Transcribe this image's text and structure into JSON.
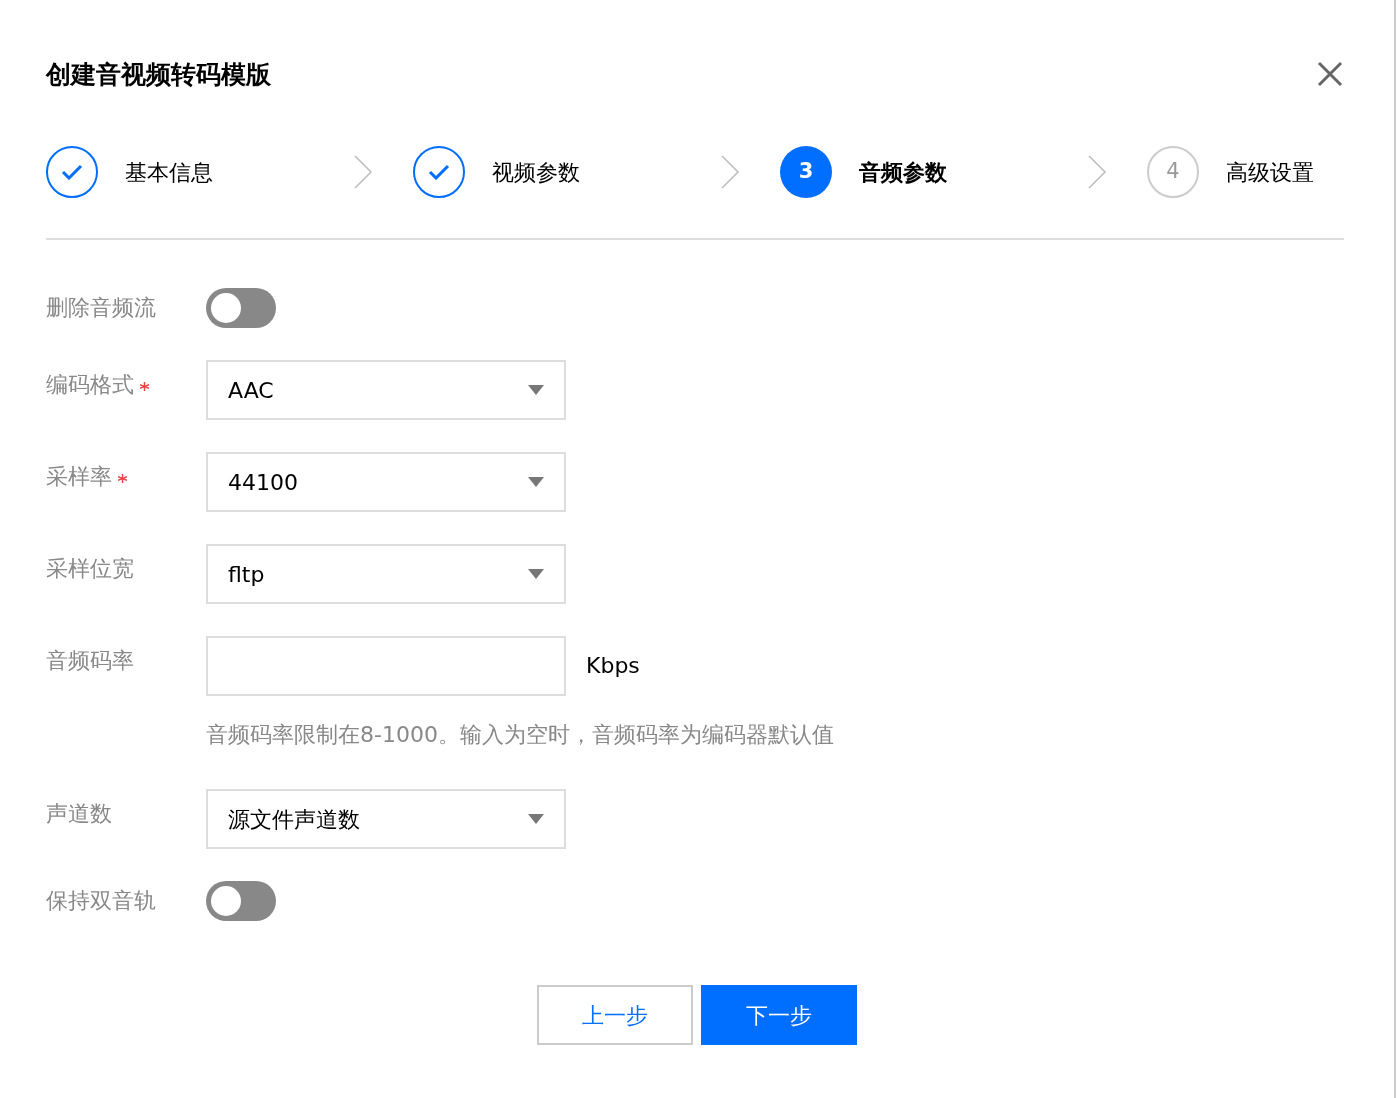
{
  "dialog": {
    "title": "创建音视频转码模版"
  },
  "steps": [
    {
      "label": "基本信息",
      "done": true,
      "selected": false
    },
    {
      "label": "视频参数",
      "done": true,
      "selected": false
    },
    {
      "label": "音频参数",
      "done": false,
      "selected": true,
      "number": "3"
    },
    {
      "label": "高级设置",
      "done": false,
      "selected": false,
      "number": "4"
    }
  ],
  "fields": [
    {
      "kind": "toggle",
      "label": "删除音频流",
      "on": false
    },
    {
      "kind": "select",
      "label": "编码格式",
      "required": true,
      "value": "AAC"
    },
    {
      "kind": "select",
      "label": "采样率",
      "required": true,
      "value": "44100"
    },
    {
      "kind": "select",
      "label": "采样位宽",
      "required": false,
      "value": "fltp"
    },
    {
      "kind": "input",
      "label": "音频码率",
      "unit": "Kbps",
      "hint": "音频码率限制在8-1000。输入为空时，音频码率为编码器默认值"
    },
    {
      "kind": "select",
      "label": "声道数",
      "required": false,
      "value": "源文件声道数"
    },
    {
      "kind": "toggle",
      "label": "保持双音轨",
      "on": false
    }
  ],
  "buttons": [
    {
      "label": "上一步",
      "kind": "secondary"
    },
    {
      "label": "下一步",
      "kind": "primary"
    }
  ]
}
